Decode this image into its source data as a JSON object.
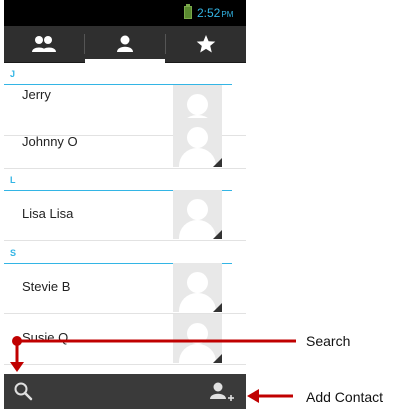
{
  "status_bar": {
    "time": "2:52",
    "ampm": "PM"
  },
  "tabs": [
    {
      "id": "groups",
      "icon": "groups-icon"
    },
    {
      "id": "contacts",
      "icon": "person-icon",
      "selected": true
    },
    {
      "id": "favorites",
      "icon": "star-icon"
    }
  ],
  "contacts": {
    "sections": [
      {
        "letter": "J",
        "items": [
          {
            "name": "Jerry"
          },
          {
            "name": "Johnny O"
          }
        ]
      },
      {
        "letter": "L",
        "items": [
          {
            "name": "Lisa Lisa"
          }
        ]
      },
      {
        "letter": "S",
        "items": [
          {
            "name": "Stevie B"
          },
          {
            "name": "Susie Q"
          }
        ]
      }
    ]
  },
  "bottom_bar": {
    "search_icon": "search-icon",
    "add_contact_icon": "add-contact-icon"
  },
  "callouts": {
    "search": "Search",
    "add_contact": "Add Contact"
  },
  "colors": {
    "accent": "#33b5e5",
    "pointer": "#c00000",
    "bar": "#2f2f2f"
  }
}
